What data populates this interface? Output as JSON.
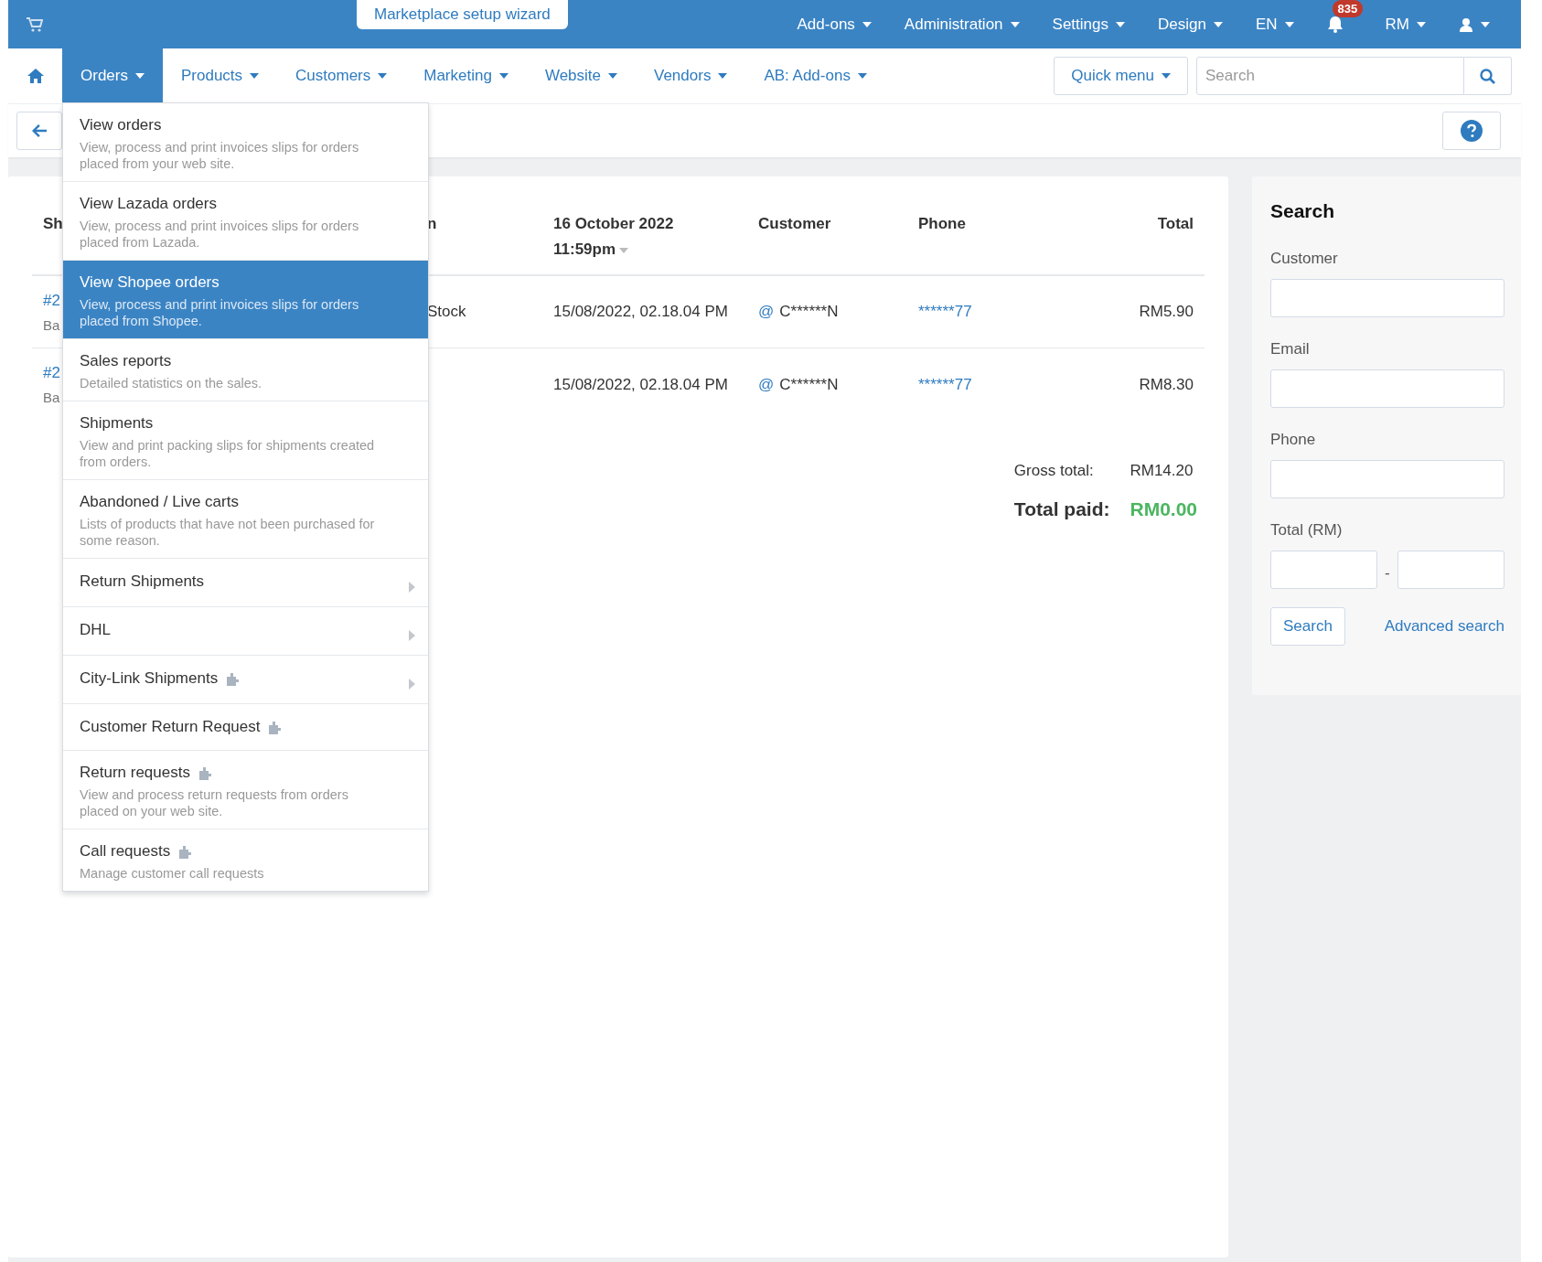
{
  "top_bar": {
    "wizard_button": "Marketplace setup wizard",
    "items": [
      {
        "kind": "menu",
        "label": "Add-ons"
      },
      {
        "kind": "menu",
        "label": "Administration"
      },
      {
        "kind": "menu",
        "label": "Settings"
      },
      {
        "kind": "menu",
        "label": "Design"
      },
      {
        "kind": "menu",
        "label": "EN"
      },
      {
        "kind": "bell",
        "badge": "835"
      },
      {
        "kind": "menu",
        "label": "RM"
      },
      {
        "kind": "user"
      }
    ]
  },
  "nav": {
    "tabs": [
      {
        "label": "Orders",
        "selected": true
      },
      {
        "label": "Products",
        "selected": false
      },
      {
        "label": "Customers",
        "selected": false
      },
      {
        "label": "Marketing",
        "selected": false
      },
      {
        "label": "Website",
        "selected": false
      },
      {
        "label": "Vendors",
        "selected": false
      },
      {
        "label": "AB: Add-ons",
        "selected": false
      }
    ],
    "quick_menu": "Quick menu",
    "search": {
      "placeholder": "Search"
    }
  },
  "orders_menu": [
    {
      "title": "View orders",
      "description": "View, process and print invoices slips for orders placed from your web site.",
      "submenu": false,
      "addon": false,
      "selected": false
    },
    {
      "title": "View Lazada orders",
      "description": "View, process and print invoices slips for orders placed from Lazada.",
      "submenu": false,
      "addon": false,
      "selected": false
    },
    {
      "title": "View Shopee orders",
      "description": "View, process and print invoices slips for orders placed from Shopee.",
      "submenu": false,
      "addon": false,
      "selected": true
    },
    {
      "title": "Sales reports",
      "description": "Detailed statistics on the sales.",
      "submenu": false,
      "addon": false,
      "selected": false
    },
    {
      "title": "Shipments",
      "description": "View and print packing slips for shipments created from orders.",
      "submenu": false,
      "addon": false,
      "selected": false
    },
    {
      "title": "Abandoned / Live carts",
      "description": "Lists of products that have not been purchased for some reason.",
      "submenu": false,
      "addon": false,
      "selected": false
    },
    {
      "title": "Return Shipments",
      "submenu": true,
      "addon": false,
      "selected": false
    },
    {
      "title": "DHL",
      "submenu": true,
      "addon": false,
      "selected": false
    },
    {
      "title": "City-Link Shipments",
      "submenu": true,
      "addon": true,
      "selected": false
    },
    {
      "title": "Customer Return Request",
      "submenu": false,
      "addon": true,
      "selected": false
    },
    {
      "title": "Return requests",
      "description": "View and process return requests from orders placed on your web site.",
      "submenu": false,
      "addon": true,
      "selected": false
    },
    {
      "title": "Call requests",
      "description": "Manage customer call requests",
      "submenu": false,
      "addon": true,
      "selected": false
    }
  ],
  "table": {
    "columns": [
      {
        "label": "Sh",
        "sorted": false
      },
      {
        "label": "n",
        "sorted": false
      },
      {
        "label": "16 October 2022 11:59pm",
        "sorted": true
      },
      {
        "label": "Customer",
        "sorted": false
      },
      {
        "label": "Phone",
        "sorted": false
      },
      {
        "label": "Total",
        "sorted": false
      }
    ],
    "rows": [
      {
        "column_1": "#2",
        "column_1_note": "Ba",
        "column_2": "Stock",
        "date": "15/08/2022, 02.18.04 PM",
        "customer_icon": "@",
        "customer": "C******N",
        "phone": "******77",
        "total": "RM5.90"
      },
      {
        "column_1": "#2",
        "column_1_note": "Ba",
        "date": "15/08/2022, 02.18.04 PM",
        "customer_icon": "@",
        "customer": "C******N",
        "phone": "******77",
        "total": "RM8.30"
      }
    ]
  },
  "totals": {
    "gross_label": "Gross total:",
    "gross_value": "RM14.20",
    "paid_label": "Total paid:",
    "paid_value": "RM0.00"
  },
  "search_panel": {
    "title": "Search",
    "fields": [
      {
        "label": "Customer"
      },
      {
        "label": "Email"
      },
      {
        "label": "Phone"
      }
    ],
    "range_label": "Total (RM)",
    "range_separator": "-",
    "search_button": "Search",
    "advanced_link": "Advanced search"
  }
}
